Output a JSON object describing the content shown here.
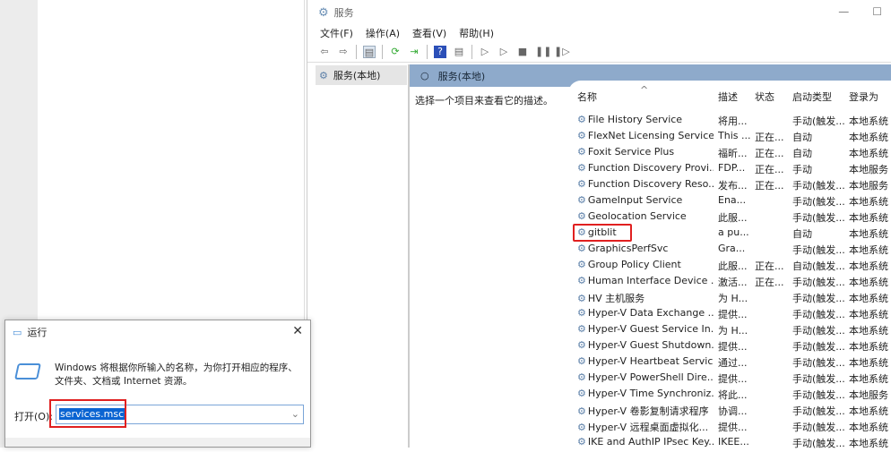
{
  "services_window": {
    "title": "服务",
    "menu": [
      "文件(F)",
      "操作(A)",
      "查看(V)",
      "帮助(H)"
    ],
    "tree_item": "服务(本地)",
    "content_header": "服务(本地)",
    "description_hint": "选择一个项目来查看它的描述。",
    "columns": [
      "名称",
      "描述",
      "状态",
      "启动类型",
      "登录为"
    ],
    "rows": [
      [
        "File History Service",
        "将用...",
        "",
        "手动(触发...",
        "本地系统"
      ],
      [
        "FlexNet Licensing Service",
        "This ...",
        "正在...",
        "自动",
        "本地系统"
      ],
      [
        "Foxit Service Plus",
        "福昕...",
        "正在...",
        "自动",
        "本地系统"
      ],
      [
        "Function Discovery Provi...",
        "FDP...",
        "正在...",
        "手动",
        "本地服务"
      ],
      [
        "Function Discovery Reso...",
        "发布...",
        "正在...",
        "手动(触发...",
        "本地服务"
      ],
      [
        "GameInput Service",
        "Ena...",
        "",
        "手动(触发...",
        "本地系统"
      ],
      [
        "Geolocation Service",
        "此服...",
        "",
        "手动(触发...",
        "本地系统"
      ],
      [
        "gitblit",
        "a pu...",
        "",
        "自动",
        "本地系统"
      ],
      [
        "GraphicsPerfSvc",
        "Gra...",
        "",
        "手动(触发...",
        "本地系统"
      ],
      [
        "Group Policy Client",
        "此服...",
        "正在...",
        "自动(触发...",
        "本地系统"
      ],
      [
        "Human Interface Device ...",
        "激活...",
        "正在...",
        "手动(触发...",
        "本地系统"
      ],
      [
        "HV 主机服务",
        "为 H...",
        "",
        "手动(触发...",
        "本地系统"
      ],
      [
        "Hyper-V Data Exchange ...",
        "提供...",
        "",
        "手动(触发...",
        "本地系统"
      ],
      [
        "Hyper-V Guest Service In...",
        "为 H...",
        "",
        "手动(触发...",
        "本地系统"
      ],
      [
        "Hyper-V Guest Shutdown...",
        "提供...",
        "",
        "手动(触发...",
        "本地系统"
      ],
      [
        "Hyper-V Heartbeat Service",
        "通过...",
        "",
        "手动(触发...",
        "本地系统"
      ],
      [
        "Hyper-V PowerShell Dire...",
        "提供...",
        "",
        "手动(触发...",
        "本地系统"
      ],
      [
        "Hyper-V Time Synchroniz...",
        "将此...",
        "",
        "手动(触发...",
        "本地服务"
      ],
      [
        "Hyper-V 卷影复制请求程序",
        "协调...",
        "",
        "手动(触发...",
        "本地系统"
      ],
      [
        "Hyper-V 远程桌面虚拟化...",
        "提供...",
        "",
        "手动(触发...",
        "本地系统"
      ],
      [
        "IKE and AuthIP IPsec Key...",
        "IKEE...",
        "",
        "手动(触发...",
        "本地系统"
      ]
    ],
    "highlighted_row": "gitblit"
  },
  "run_dialog": {
    "title": "运行",
    "description_line1": "Windows 将根据你所输入的名称，为你打开相应的程序、",
    "description_line2": "文件夹、文档或 Internet 资源。",
    "open_label": "打开(O):",
    "input_value": "services.msc"
  },
  "colors": {
    "header_blue": "#8eaacb",
    "highlight_red": "#e02020",
    "selection_blue": "#0a64d2"
  }
}
